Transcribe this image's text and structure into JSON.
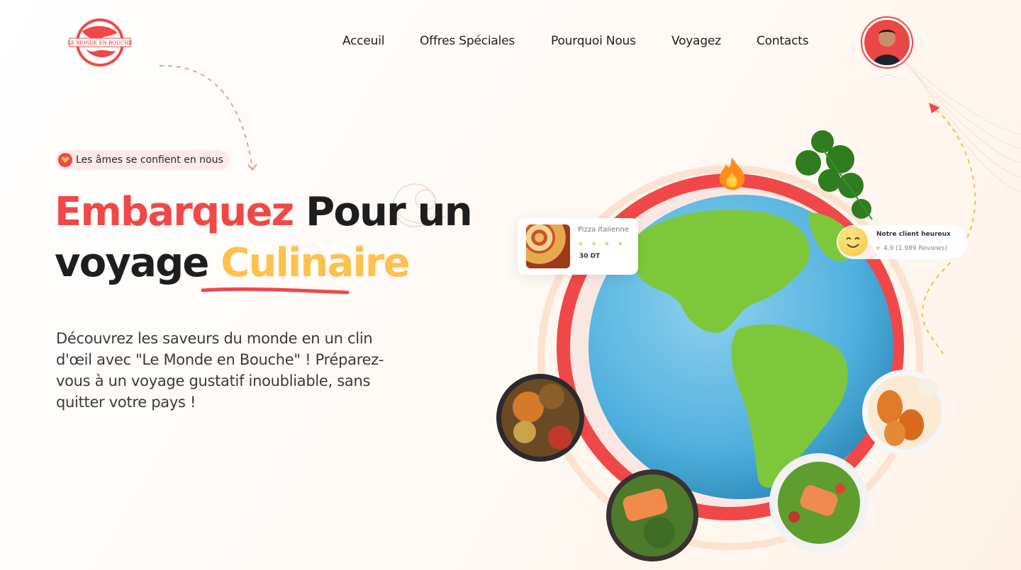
{
  "brand": {
    "logo_text": "LE MONDE EN BOUCHE",
    "accent_red": "#f04848",
    "accent_yellow": "#fec14e"
  },
  "nav": {
    "items": [
      {
        "label": "Acceuil"
      },
      {
        "label": "Offres Spéciales"
      },
      {
        "label": "Pourquoi Nous"
      },
      {
        "label": "Voyagez"
      },
      {
        "label": "Contacts"
      }
    ]
  },
  "user": {
    "avatar_icon": "user-avatar"
  },
  "hero": {
    "badge": "Les âmes se confient en nous",
    "headline_part1": "Embarquez",
    "headline_part2": " Pour un",
    "headline_part3": "voyage ",
    "headline_part4": "Culinaire",
    "description": "Découvrez les saveurs du monde en un clin d'œil avec \"Le Monde en Bouche\" ! Préparez-vous à un voyage gustatif inoubliable, sans quitter votre pays !"
  },
  "pizza_card": {
    "name": "Pizza Italienne",
    "stars": "★ ★ ★ ★ ☆",
    "rating": 4,
    "price": "30 DT"
  },
  "review_card": {
    "title": "Notre client heureux",
    "star": "★",
    "rating_text": "4.9 (1.989 Reviews)"
  }
}
